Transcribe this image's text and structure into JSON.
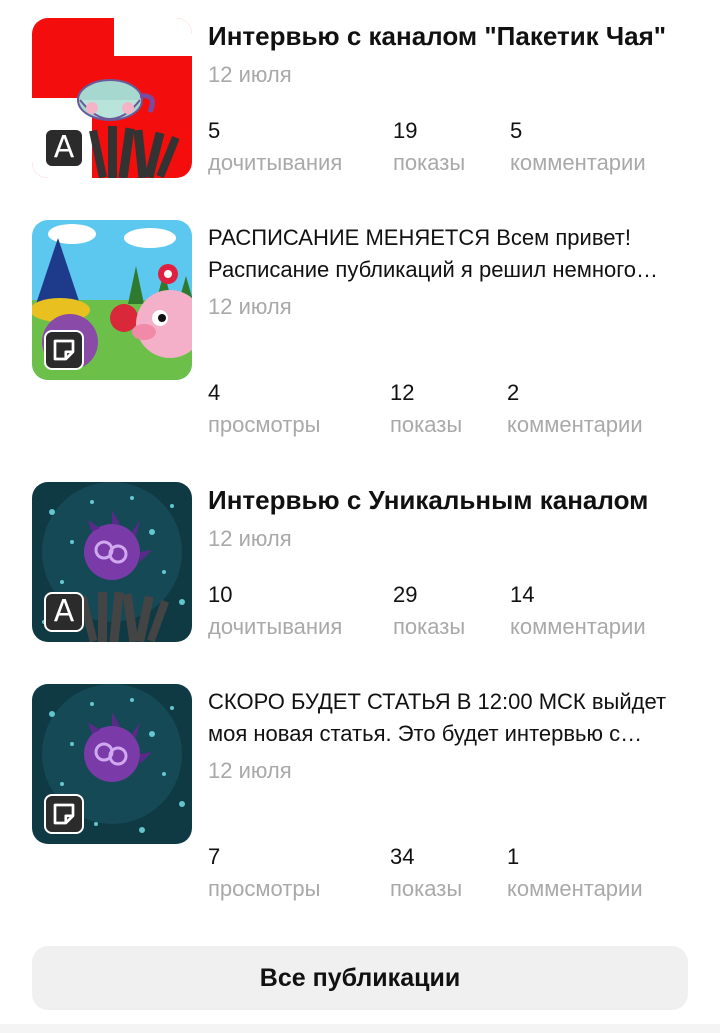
{
  "posts": [
    {
      "title": "Интервью с каналом \"Пакетик Чая\"",
      "title_bold": true,
      "date": "12 июля",
      "type_icon": "article-icon",
      "badge_letter": "A",
      "stats": [
        {
          "value": "5",
          "label": "дочитывания"
        },
        {
          "value": "19",
          "label": "показы"
        },
        {
          "value": "5",
          "label": "комментарии"
        }
      ]
    },
    {
      "title": "РАСПИСАНИЕ МЕНЯЕТСЯ Всем привет! Расписание публикаций я решил немного…",
      "title_bold": false,
      "date": "12 июля",
      "type_icon": "post-note-icon",
      "stats": [
        {
          "value": "4",
          "label": "просмотры"
        },
        {
          "value": "12",
          "label": "показы"
        },
        {
          "value": "2",
          "label": "комментарии"
        }
      ]
    },
    {
      "title": "Интервью с Уникальным каналом",
      "title_bold": true,
      "date": "12 июля",
      "type_icon": "article-icon",
      "badge_letter": "A",
      "stats": [
        {
          "value": "10",
          "label": "дочитывания"
        },
        {
          "value": "29",
          "label": "показы"
        },
        {
          "value": "14",
          "label": "комментарии"
        }
      ]
    },
    {
      "title": "СКОРО БУДЕТ СТАТЬЯ В 12:00 МСК выйдет моя новая статья. Это будет интервью с…",
      "title_bold": false,
      "date": "12 июля",
      "type_icon": "post-note-icon",
      "stats": [
        {
          "value": "7",
          "label": "просмотры"
        },
        {
          "value": "34",
          "label": "показы"
        },
        {
          "value": "1",
          "label": "комментарии"
        }
      ]
    }
  ],
  "all_publications_label": "Все публикации",
  "colors": {
    "text": "#111111",
    "muted": "#a9a9a9",
    "button_bg": "#f0f0f0",
    "badge_bg": "#2b2b2b"
  }
}
